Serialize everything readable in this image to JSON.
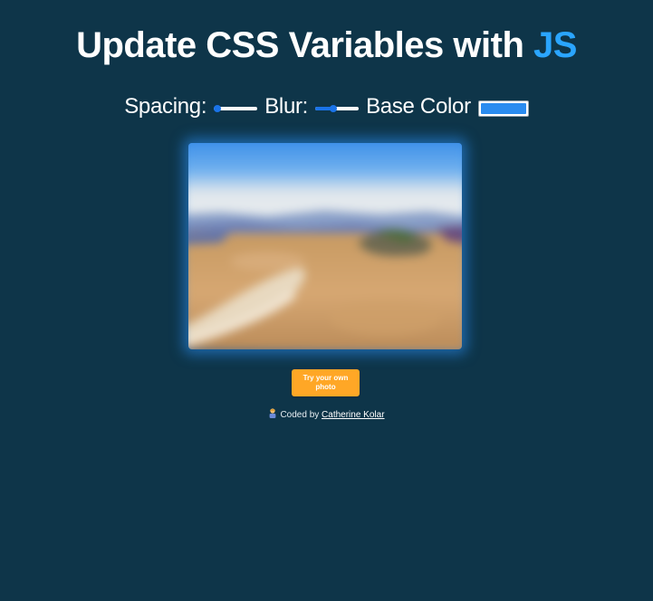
{
  "title": {
    "text": "Update CSS Variables with ",
    "highlight": "JS",
    "highlight_color": "#2aa5ff"
  },
  "controls": {
    "spacing": {
      "label": "Spacing:",
      "value": 0,
      "min": 0,
      "max": 200
    },
    "blur": {
      "label": "Blur:",
      "value": 10,
      "min": 0,
      "max": 25
    },
    "base_color": {
      "label": "Base Color",
      "value": "#2a8cf0"
    }
  },
  "upload_button": {
    "label": "Try your own photo"
  },
  "credit": {
    "prefix": "Coded by ",
    "author": "Catherine Kolar",
    "icon": "person-emoji-icon"
  },
  "colors": {
    "background": "#0e3549",
    "button": "#ffa726",
    "slider_accent": "#1a73e8"
  }
}
